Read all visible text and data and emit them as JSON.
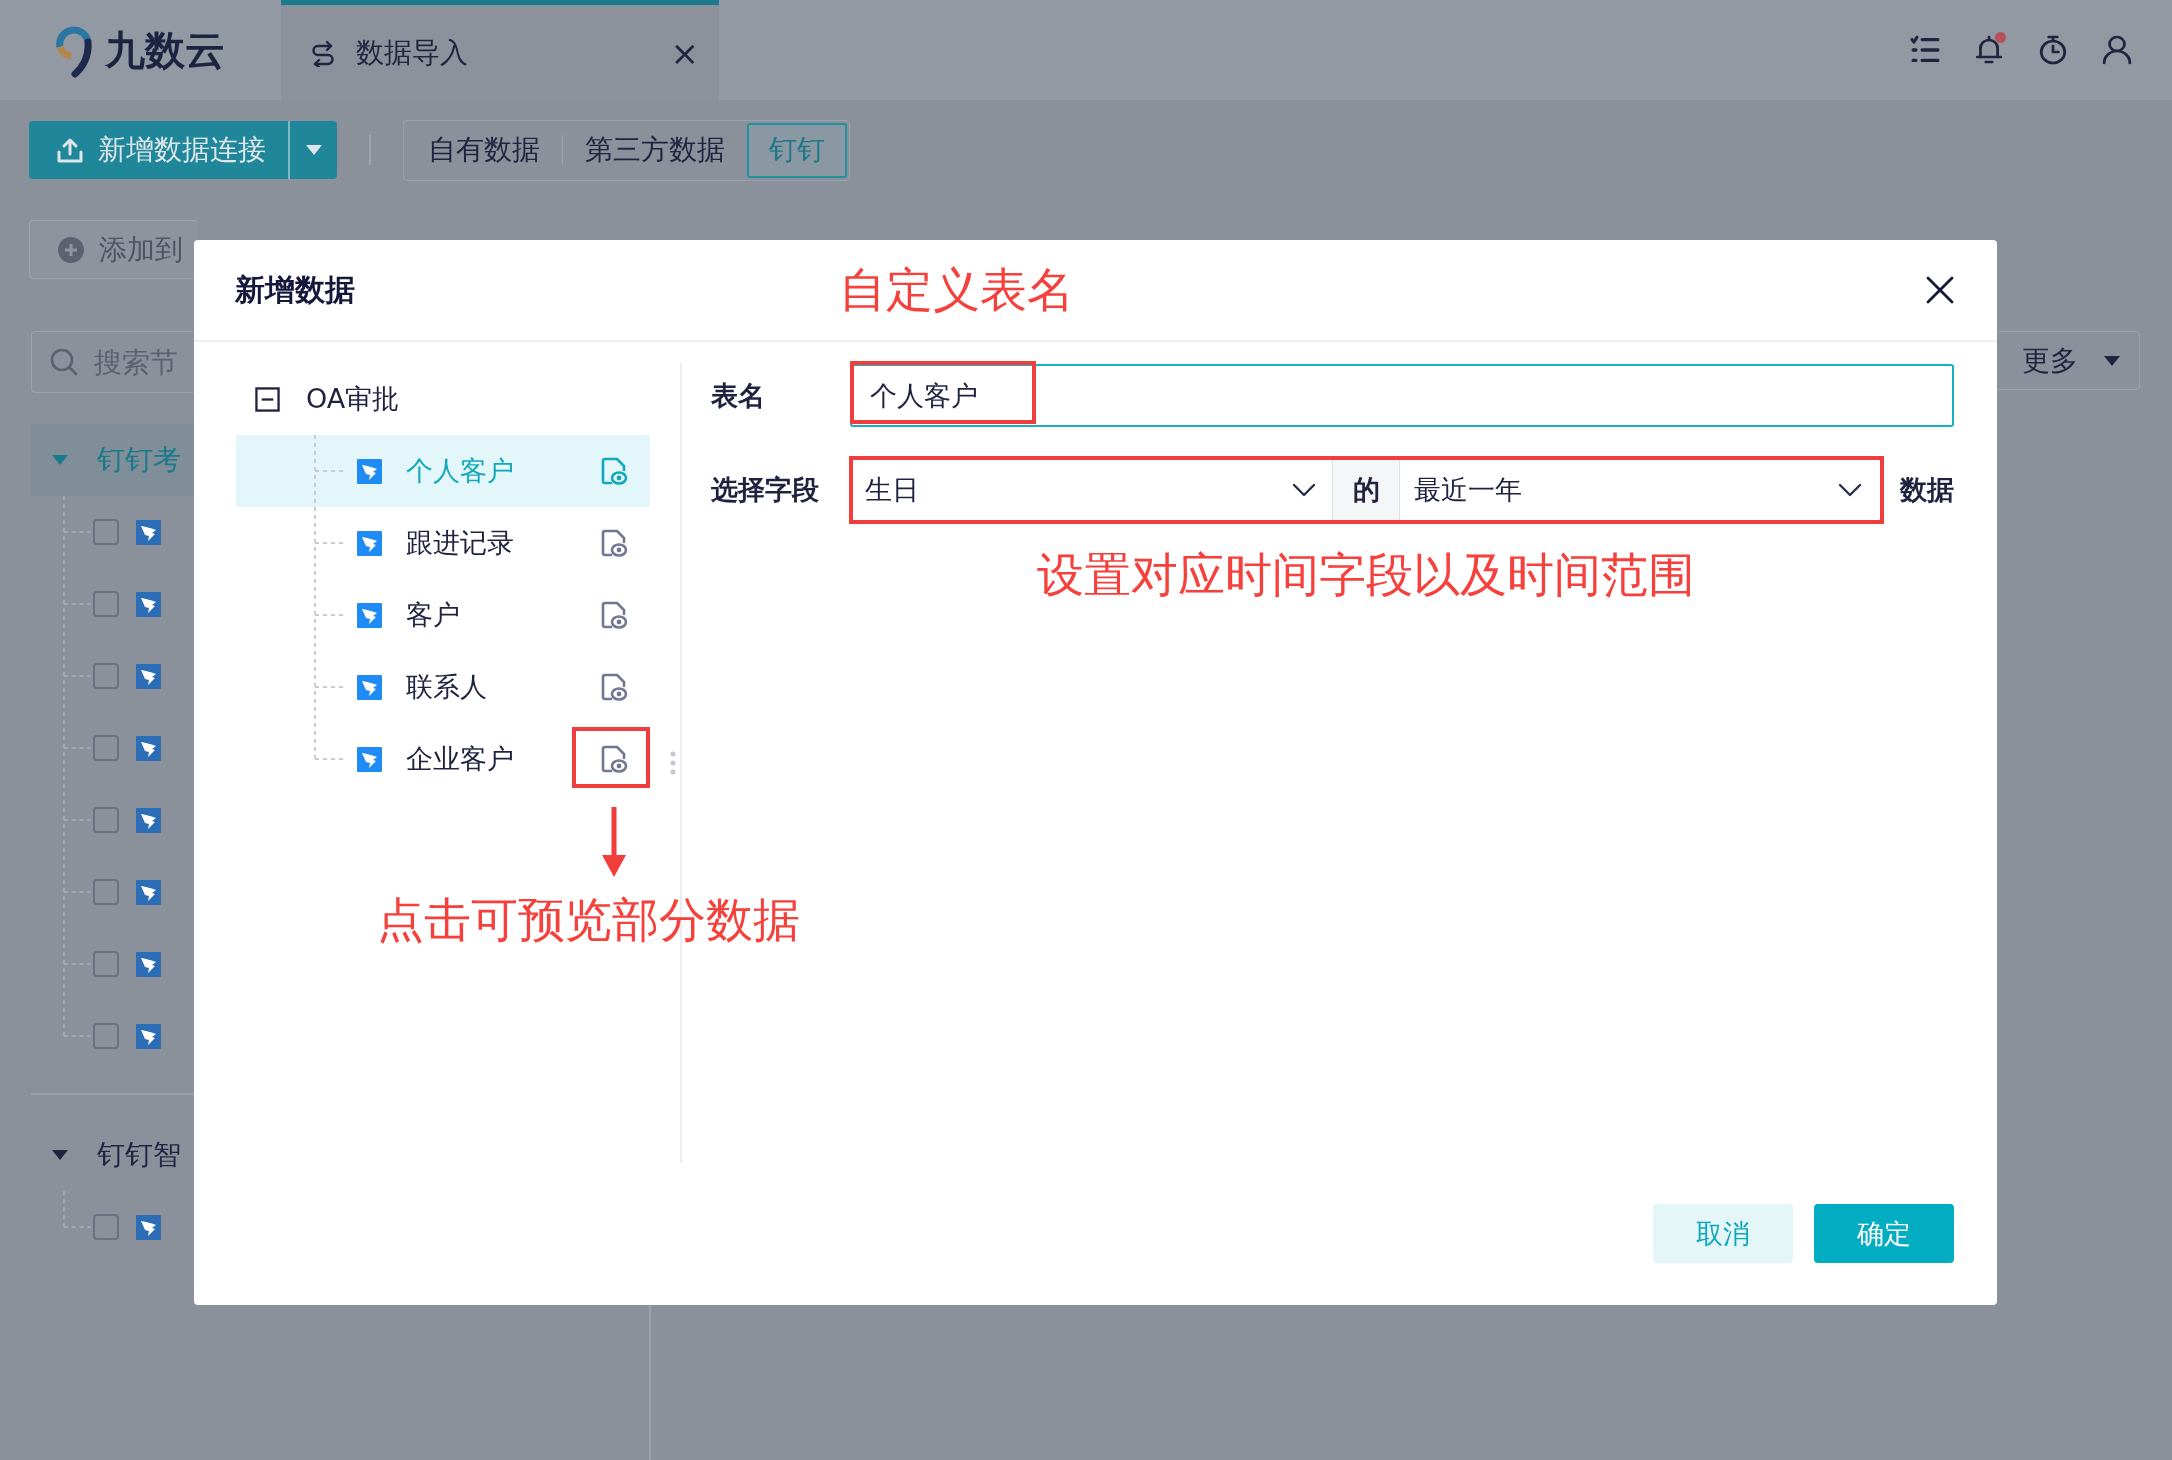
{
  "header": {
    "logo": {
      "text": "九数云"
    },
    "tabs": [
      {
        "label": "数据导入",
        "selected": true,
        "close": "×"
      }
    ],
    "icons": [
      {
        "kind": "checklist",
        "badge": false
      },
      {
        "kind": "bell",
        "badge": true
      },
      {
        "kind": "timer",
        "badge": false
      },
      {
        "kind": "user",
        "badge": false
      }
    ]
  },
  "toolbar": {
    "new_connection": {
      "label": "新增数据连接"
    },
    "source_tabs": [
      {
        "label": "自有数据",
        "selected": false
      },
      {
        "label": "第三方数据",
        "selected": false
      },
      {
        "label": "钉钉",
        "selected": true
      }
    ]
  },
  "actions": [
    {
      "label": "添加到"
    }
  ],
  "more_button": {
    "label": "更多"
  },
  "sidebar": {
    "search": {
      "placeholder": "搜索节"
    },
    "groups": [
      {
        "label": "钉钉考",
        "expanded": true,
        "selected": true,
        "children": [
          {
            "checked": false
          },
          {
            "checked": false
          },
          {
            "checked": false
          },
          {
            "checked": false
          },
          {
            "checked": false
          },
          {
            "checked": false
          },
          {
            "checked": false
          },
          {
            "checked": false
          }
        ]
      },
      {
        "label": "钉钉智",
        "expanded": true,
        "selected": false,
        "children": [
          {
            "checked": false
          }
        ]
      }
    ]
  },
  "dialog": {
    "title": "新增数据",
    "title_note": "自定义表名",
    "tree": {
      "label": "OA审批",
      "expanded": true,
      "children": [
        {
          "label": "个人客户",
          "selected": true,
          "highlighted": false
        },
        {
          "label": "跟进记录",
          "selected": false,
          "highlighted": false
        },
        {
          "label": "客户",
          "selected": false,
          "highlighted": false
        },
        {
          "label": "联系人",
          "selected": false,
          "highlighted": false
        },
        {
          "label": "企业客户",
          "selected": false,
          "highlighted": true
        }
      ],
      "note": {
        "text": "点击可预览部分数据",
        "arrow": true
      }
    },
    "form": {
      "table_name": {
        "label": "表名",
        "value": "个人客户",
        "highlighted": true
      },
      "time_filter": {
        "label": "选择字段",
        "field": "生日",
        "connector": "的",
        "range": "最近一年",
        "suffix": "数据",
        "highlighted": true,
        "note": "设置对应时间字段以及时间范围"
      }
    },
    "buttons": [
      {
        "label": "取消",
        "kind": "secondary"
      },
      {
        "label": "确定",
        "kind": "primary"
      }
    ]
  }
}
